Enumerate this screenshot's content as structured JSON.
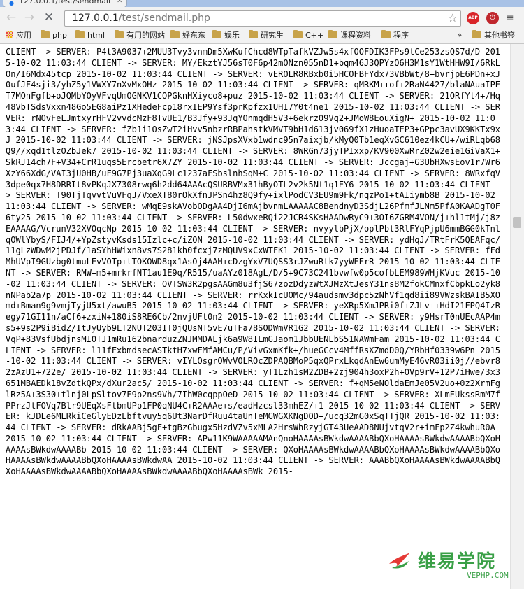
{
  "browser": {
    "tab_title": "127.0.0.1/test/sendmail",
    "url_host": "127.0.0.1",
    "url_path": "/test/sendmail.php",
    "ext_abp": "ABP"
  },
  "bookmarks": {
    "apps": "应用",
    "items": [
      "php",
      "html",
      "有用的网站",
      "好东东",
      "娱乐",
      "研究生",
      "C++",
      "课程资料",
      "程序"
    ],
    "overflow": "»",
    "other": "其他书签"
  },
  "log_text": "CLIENT -> SERVER: P4t3A9037+2MUU3Tvy3vnmDm5XwKufChcd8WTpTafkVZJw5s4xfOOFDIK3FPs9tCe253zsQS7d/D 2015-10-02 11:03:44 CLIENT -> SERVER: MY/EkztYJ56sT0F6p42mONzn055nD1+bqm46J3QPYzQ6H3M1sY1WtHHW9I/6RkLOn/I6Mdx45tcp 2015-10-02 11:03:44 CLIENT -> SERVER: vEROLR8RBxb0i5HCOFBFYdx73VBbWt/8+bvrjpE6PDn+xJ0ufJF4sji3/yhZ5y1VWXY7nXvMxOHz 2015-10-02 11:03:44 CLIENT -> SERVER: qMRKM++of+2RaN4427/blaNAuaIPET7MOnFgfb+oJQMbYOyVFvqUmOGNKV1COPGknHXiyco8+puz 2015-10-02 11:03:44 CLIENT -> SERVER: 21ORfYt4+/Hq48VbTSdsVxxn48Go5EG8aiPz1XHedeFcp18rxIEP9Ysf3prKpfzx1UHI7Y0t4ne1 2015-10-02 11:03:44 CLIENT -> SERVER: rNOvFeLJmtxyrHFV2vvdcMzF8TvUE1/B3Jfy+93JqYOnmqdH5V3+6ekrz09Vq2+JMoW8EouXigN+ 2015-10-02 11:03:44 CLIENT -> SERVER: fZb1i1OsZwT2iHvv5nbzrRBPahstkVMVT9bH1d613jv069fX1zHuoaTEP3+GPpc3avUX9KKTx9xJ 2015-10-02 11:03:44 CLIENT -> SERVER: jNSJpsXVxb1wdnc95n7aixjb/kMyQ0Tb1eqXvGC610ez4kCU+/wiRLqb68Q9//xqd1tlzOZbJek7 2015-10-02 11:03:44 CLIENT -> SERVER: 8WRGn73jyTPIxxp/KV900XwRrZ02w2eie1GiVaX1+SkRJ14ch7F+V34+CrR1uqs5Ercbetr6X7ZY 2015-10-02 11:03:44 CLIENT -> SERVER: Jccgaj+G3UbHXwsEov1r7Wr6XzY66XdG/VAI3jU0HB/uF9G7Pj3uaXqG9Lc1237aFSbslnhSqM+C 2015-10-02 11:03:44 CLIENT -> SERVER: 8WRxfqV3dpe0qx7H8DRRIt8vPKqJX7308rwq6h2dd64AAAcQSURBVMx31hByOTL2v2k5Nt1q1EY6 2015-10-02 11:03:44 CLIENT -> SERVER: T90TjTqvvtVuVFqJ/VxeXT80rOkXfnJPSn4hz8Q9fy+ixlPodCV3EU9m9Fk/nqzPo1+tAIiymb8B 2015-10-02 11:03:44 CLIENT -> SERVER: wMqE9skAVobODgAA4DjI6mAjbvnmLAAAAAC8BendnyD3SdjL26PfmfJLNm5PfA0KAADgT0F6ty25 2015-10-02 11:03:44 CLIENT -> SERVER: L50dwxeRQi22JCR4SKsHAADwRyC9+3OI6ZGRM4VON/j+hl1tMj/j8zEAAAAG/VcrunV32XVOqcNp 2015-10-02 11:03:44 CLIENT -> SERVER: nvyylbPjX/oplPbt3RlFYqPjpU6mmBGG0kTnlqOWlYbyS/FIJ4/+YpZstyvKsds15Izlc+c/iZON 2015-10-02 11:03:44 CLIENT -> SERVER: ydHqJ/TRtFrK5QEAFqc/11gLzWDwM2jPDJf/1aSYhHWixn8vs7S281kh0fcxj7zMQUV9xCxWTFK1 2015-10-02 11:03:44 CLIENT -> SERVER: fFdMhUVpI9GUzbg0tmuLEvVOTp+tTOKOWD8qx1AsOj4AAH+cDzgYxV7UQSS3rJZwuRtk7yyWEErR 2015-10-02 11:03:44 CLIENT -> SERVER: RMW+m5+mrkrfNT1au1E9q/R515/uaAYz018AgL/D/5+9C73C241bvwfw0p5cofbLEM989WHjKVuc 2015-10-02 11:03:44 CLIENT -> SERVER: OVTSW3R2pgsAAGm8u3fjS67zozDdyzWtXJMzXtJesY31ns8M2fokCMnxfCbpkLo2yk8nNPab2a7p 2015-10-02 11:03:44 CLIENT -> SERVER: rrKxkIcUOMc/94audsmv3dpc5zNhVf1qd8ii89VWzskBAIB5XOmd+Bman9g9vmjTyjU5xt/awuB5 2015-10-02 11:03:44 CLIENT -> SERVER: yeXRp5XmJPRi0f+ZJLv++HdI21FPQ4IzRegy71GI11n/aCf6+zxiN+180iS8RE6Cb/2nvjUFt0n2 2015-10-02 11:03:44 CLIENT -> SERVER: y9HsrT0nUEcAAP4ms5+9s2P9iBidZ/ItJyUyb9LT2NUT203IT0jQUsNT5vE7uTFa78SODWmVR1G2 2015-10-02 11:03:44 CLIENT -> SERVER: VqP+83VsfUbdjnsMI0TJ1mRu162bnarduzZNJMMDALjk6a9W8ILmGJaom1JbbUENLbS51NAWmFam 2015-10-02 11:03:44 CLIENT -> SERVER: l11fFxbmdsecASTktH7xwFMfAMCu/P/VivGxmKfk+/hueGCcv4MffRsXZmdD0Q/YRbHf0339w6Pn 2015-10-02 11:03:44 CLIENT -> SERVER: vIYLOsgrOWvVOLROcZDPAQBMoP5qxQPrxLkqdAnEw6umMyE46vR03ii0j//ebvr82zAzU1+722e/ 2015-10-02 11:03:44 CLIENT -> SERVER: yT1Lzh1sM2ZDB+2zj904h3oxP2h+OVp9rV+12P7iHwe/3x3651MBAEDk18vZdtkQPx/dXur2ac5/ 2015-10-02 11:03:44 CLIENT -> SERVER: f+qM5eNOldaEmJe05V2uo+0z2XrmFglRz5A+3S30+tlnj0LpSltov7E9p2ns9Vh/7IhW0cqppOeD 2015-10-02 11:03:44 CLIENT -> SERVER: XLmEUkssRmM7fPPrzJtFOVq7Blr9UEqXsFtbmUPp1FP0qNU4C+R2AAAe+s/eadHzcsl33mhEZ/+1 2015-10-02 11:03:44 CLIENT -> SERVER: kJDLe6MLRkiCeGlyEDzLbftvuy5q6Ut3NarDfRuu4taUnTeMGWGXKNgDOD+/ucq32mG0xSqTTjQR 2015-10-02 11:03:44 CLIENT -> SERVER: dRkAABj5gF+tgBzGbugx5HzdVZv5xMLA2HrsWhRzyjGT43UeAAD8NUjvtqV2r+imFp2Z4kwhuR0A 2015-10-02 11:03:44 CLIENT -> SERVER: APw11K9WAAAAAMAnQnoHAAAAsBWkdwAAAABbQXoHAAAAsBWkdwAAAABbQXoHAAAAsBWkdwAAAABb 2015-10-02 11:03:44 CLIENT -> SERVER: QXoHAAAAsBWkdwAAAABbQXoHAAAAsBWkdwAAAABbQXoHAAAAsBWkdwAAAABbQXoHAAAAsBWkdwAA 2015-10-02 11:03:44 CLIENT -> SERVER: AAABbQXoHAAAAsBWkdwAAAABbQXoHAAAAsBWkdwAAAABbQXoHAAAAsBWkdwAAAABbQXoHAAAAsBWk 2015-",
  "watermark": {
    "text": "维易学院",
    "url": "VEPHP.COM"
  }
}
